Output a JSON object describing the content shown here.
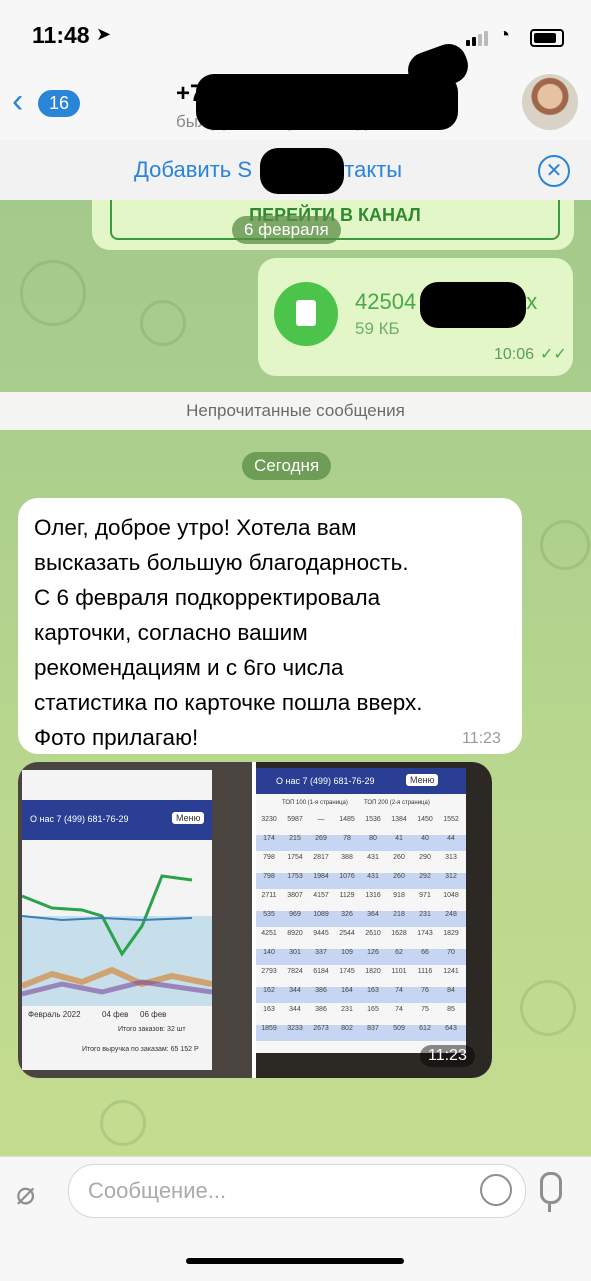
{
  "status_bar": {
    "time": "11:48",
    "location_glyph": "➤",
    "wifi_glyph": "◔"
  },
  "header": {
    "back_glyph": "‹",
    "back_badge": "16",
    "contact_title": "+7",
    "last_seen": "был(а) 24 минуты назад"
  },
  "contact_bar": {
    "add_label": "Добавить S",
    "add_label_end": "контакты",
    "close_glyph": "✕"
  },
  "messages": {
    "channel_button": "ПЕРЕЙТИ В КАНАЛ",
    "date_separator_1": "6 февраля",
    "file": {
      "name": "42504",
      "name_end": "x",
      "size": "59 КБ",
      "time": "10:06",
      "checks": "✓✓"
    },
    "unread_label": "Непрочитанные сообщения",
    "date_separator_2": "Сегодня",
    "incoming_text": "Олег, доброе утро! Хотела вам\nвысказать большую благодарность.\nС 6 февраля подкорректировала\nкарточки, согласно вашим\nрекомендациям и с 6го числа\nстатистика по карточке пошла вверх.\nФото прилагаю!",
    "incoming_time": "11:23",
    "album_time": "11:23",
    "photo1": {
      "header_text": "О нас   7 (499) 681-76-29",
      "menu_label": "Меню",
      "x_labels": [
        "Февраль 2022",
        "04 фев",
        "06 фев"
      ],
      "orders_label": "Итого заказов: 32 шт",
      "revenue_label": "Итого выручка по заказам: 65 152 Р"
    },
    "photo2": {
      "header_text": "О нас   7 (499) 681-76-29",
      "menu_label": "Меню",
      "col_labels": [
        "ТОП 100 (1-я страница)",
        "ТОП 200 (2-я страница)"
      ],
      "rows": [
        [
          "3230",
          "5987",
          "—",
          "1485",
          "1536",
          "1384",
          "1450",
          "1552"
        ],
        [
          "174",
          "215",
          "269",
          "78",
          "80",
          "41",
          "40",
          "44"
        ],
        [
          "798",
          "1754",
          "2817",
          "388",
          "431",
          "260",
          "290",
          "313"
        ],
        [
          "798",
          "1753",
          "1984",
          "1076",
          "431",
          "260",
          "292",
          "312"
        ],
        [
          "2711",
          "3807",
          "4157",
          "1129",
          "1316",
          "918",
          "971",
          "1048"
        ],
        [
          "535",
          "969",
          "1089",
          "326",
          "364",
          "218",
          "231",
          "248"
        ],
        [
          "4251",
          "8920",
          "9445",
          "2544",
          "2610",
          "1628",
          "1743",
          "1829"
        ],
        [
          "140",
          "301",
          "337",
          "109",
          "126",
          "62",
          "66",
          "70"
        ],
        [
          "2793",
          "7824",
          "6184",
          "1745",
          "1820",
          "1101",
          "1116",
          "1241"
        ],
        [
          "162",
          "344",
          "386",
          "164",
          "163",
          "74",
          "76",
          "84"
        ],
        [
          "163",
          "344",
          "386",
          "231",
          "165",
          "74",
          "75",
          "85"
        ],
        [
          "1859",
          "3233",
          "2673",
          "802",
          "837",
          "509",
          "612",
          "643"
        ]
      ]
    }
  },
  "composer": {
    "placeholder": "Сообщение..."
  },
  "colors": {
    "accent": "#2a84d8",
    "outgoing_bubble": "#e3f6c8",
    "file_icon": "#4cc34a"
  }
}
